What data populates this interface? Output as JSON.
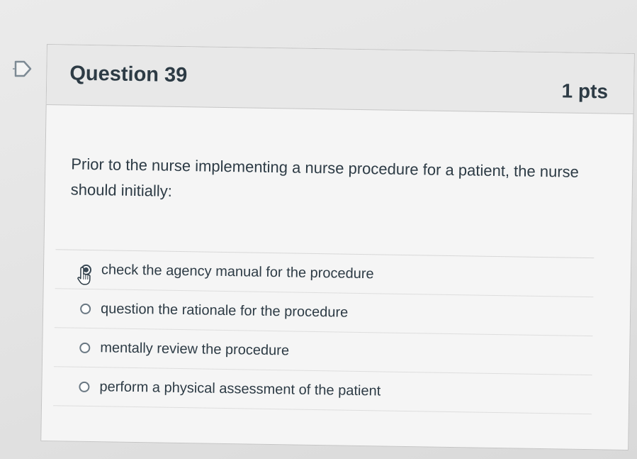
{
  "question": {
    "title": "Question 39",
    "points": "1 pts",
    "text": "Prior to the nurse implementing a nurse procedure for a patient, the nurse should initially:"
  },
  "answers": [
    {
      "label": "check the agency manual for the procedure",
      "selected": true
    },
    {
      "label": "question the rationale for the procedure",
      "selected": false
    },
    {
      "label": "mentally review the procedure",
      "selected": false
    },
    {
      "label": "perform a physical assessment of the patient",
      "selected": false
    }
  ],
  "icons": {
    "flag": "flag-question-icon",
    "cursor": "hand-pointer-icon"
  }
}
